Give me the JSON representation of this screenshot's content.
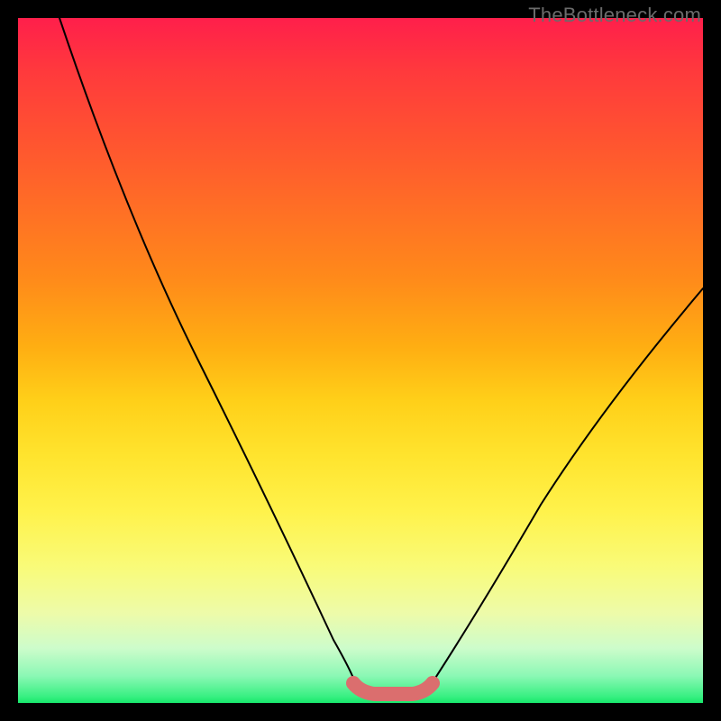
{
  "watermark": "TheBottleneck.com",
  "chart_data": {
    "type": "line",
    "title": "",
    "xlabel": "",
    "ylabel": "",
    "xlim": [
      0,
      100
    ],
    "ylim": [
      0,
      100
    ],
    "grid": false,
    "legend": false,
    "series": [
      {
        "name": "curve-left",
        "x": [
          6,
          10,
          15,
          20,
          25,
          30,
          35,
          40,
          45,
          48
        ],
        "y": [
          100,
          89,
          77,
          65,
          53,
          41,
          29,
          17,
          7,
          3
        ]
      },
      {
        "name": "curve-right",
        "x": [
          60,
          65,
          70,
          75,
          80,
          85,
          90,
          95,
          100
        ],
        "y": [
          3,
          7,
          14,
          22,
          30,
          38,
          46,
          53,
          60
        ]
      },
      {
        "name": "flat-bottom-highlight",
        "x": [
          48,
          50,
          52,
          54,
          56,
          58,
          60
        ],
        "y": [
          3,
          1.5,
          1,
          1,
          1,
          1.5,
          3
        ]
      }
    ],
    "colors": {
      "highlight": "#db6e6e",
      "curve": "#000000",
      "gradient_top": "#ff1f4b",
      "gradient_bottom": "#17e86b"
    }
  }
}
